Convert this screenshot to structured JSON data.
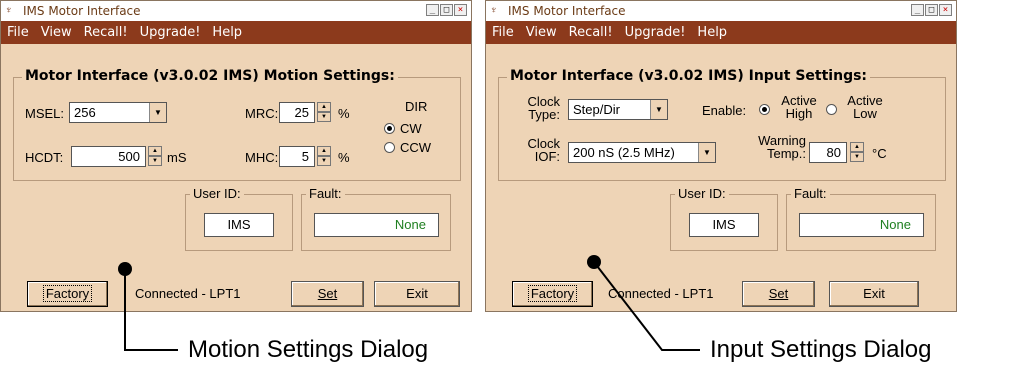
{
  "left_window": {
    "title": "IMS Motor Interface",
    "menu": [
      "File",
      "View",
      "Recall!",
      "Upgrade!",
      "Help"
    ],
    "group_title": "Motor Interface (v3.0.02 IMS) Motion Settings:",
    "msel": {
      "label": "MSEL:",
      "value": "256"
    },
    "mrc": {
      "label": "MRC:",
      "value": "25",
      "unit": "%"
    },
    "dir": {
      "label": "DIR",
      "options": [
        "CW",
        "CCW"
      ],
      "selected": "CW"
    },
    "hcdt": {
      "label": "HCDT:",
      "value": "500",
      "unit": "mS"
    },
    "mhc": {
      "label": "MHC:",
      "value": "5",
      "unit": "%"
    },
    "user_id": {
      "label": "User ID:",
      "value": "IMS"
    },
    "fault": {
      "label": "Fault:",
      "value": "None"
    },
    "buttons": {
      "factory": "Factory",
      "set": "Set",
      "exit": "Exit"
    },
    "status": "Connected - LPT1"
  },
  "right_window": {
    "title": "IMS Motor Interface",
    "menu": [
      "File",
      "View",
      "Recall!",
      "Upgrade!",
      "Help"
    ],
    "group_title": "Motor Interface (v3.0.02 IMS) Input Settings:",
    "clock_type": {
      "label_line1": "Clock",
      "label_line2": "Type:",
      "value": "Step/Dir"
    },
    "enable": {
      "label": "Enable:",
      "opt1_line1": "Active",
      "opt1_line2": "High",
      "opt2_line1": "Active",
      "opt2_line2": "Low",
      "selected": "Active High"
    },
    "clock_iof": {
      "label_line1": "Clock",
      "label_line2": "IOF:",
      "value": "200 nS (2.5 MHz)"
    },
    "warning_temp": {
      "label_line1": "Warning",
      "label_line2": "Temp.:",
      "value": "80",
      "unit": "°C"
    },
    "user_id": {
      "label": "User ID:",
      "value": "IMS"
    },
    "fault": {
      "label": "Fault:",
      "value": "None"
    },
    "buttons": {
      "factory": "Factory",
      "set": "Set",
      "exit": "Exit"
    },
    "status": "Connected - LPT1"
  },
  "captions": {
    "left": "Motion Settings Dialog",
    "right": "Input Settings Dialog"
  },
  "colors": {
    "menubar": "#8c3a1c",
    "dialog_bg": "#eed4b6",
    "fault_text": "#1f7f20"
  }
}
